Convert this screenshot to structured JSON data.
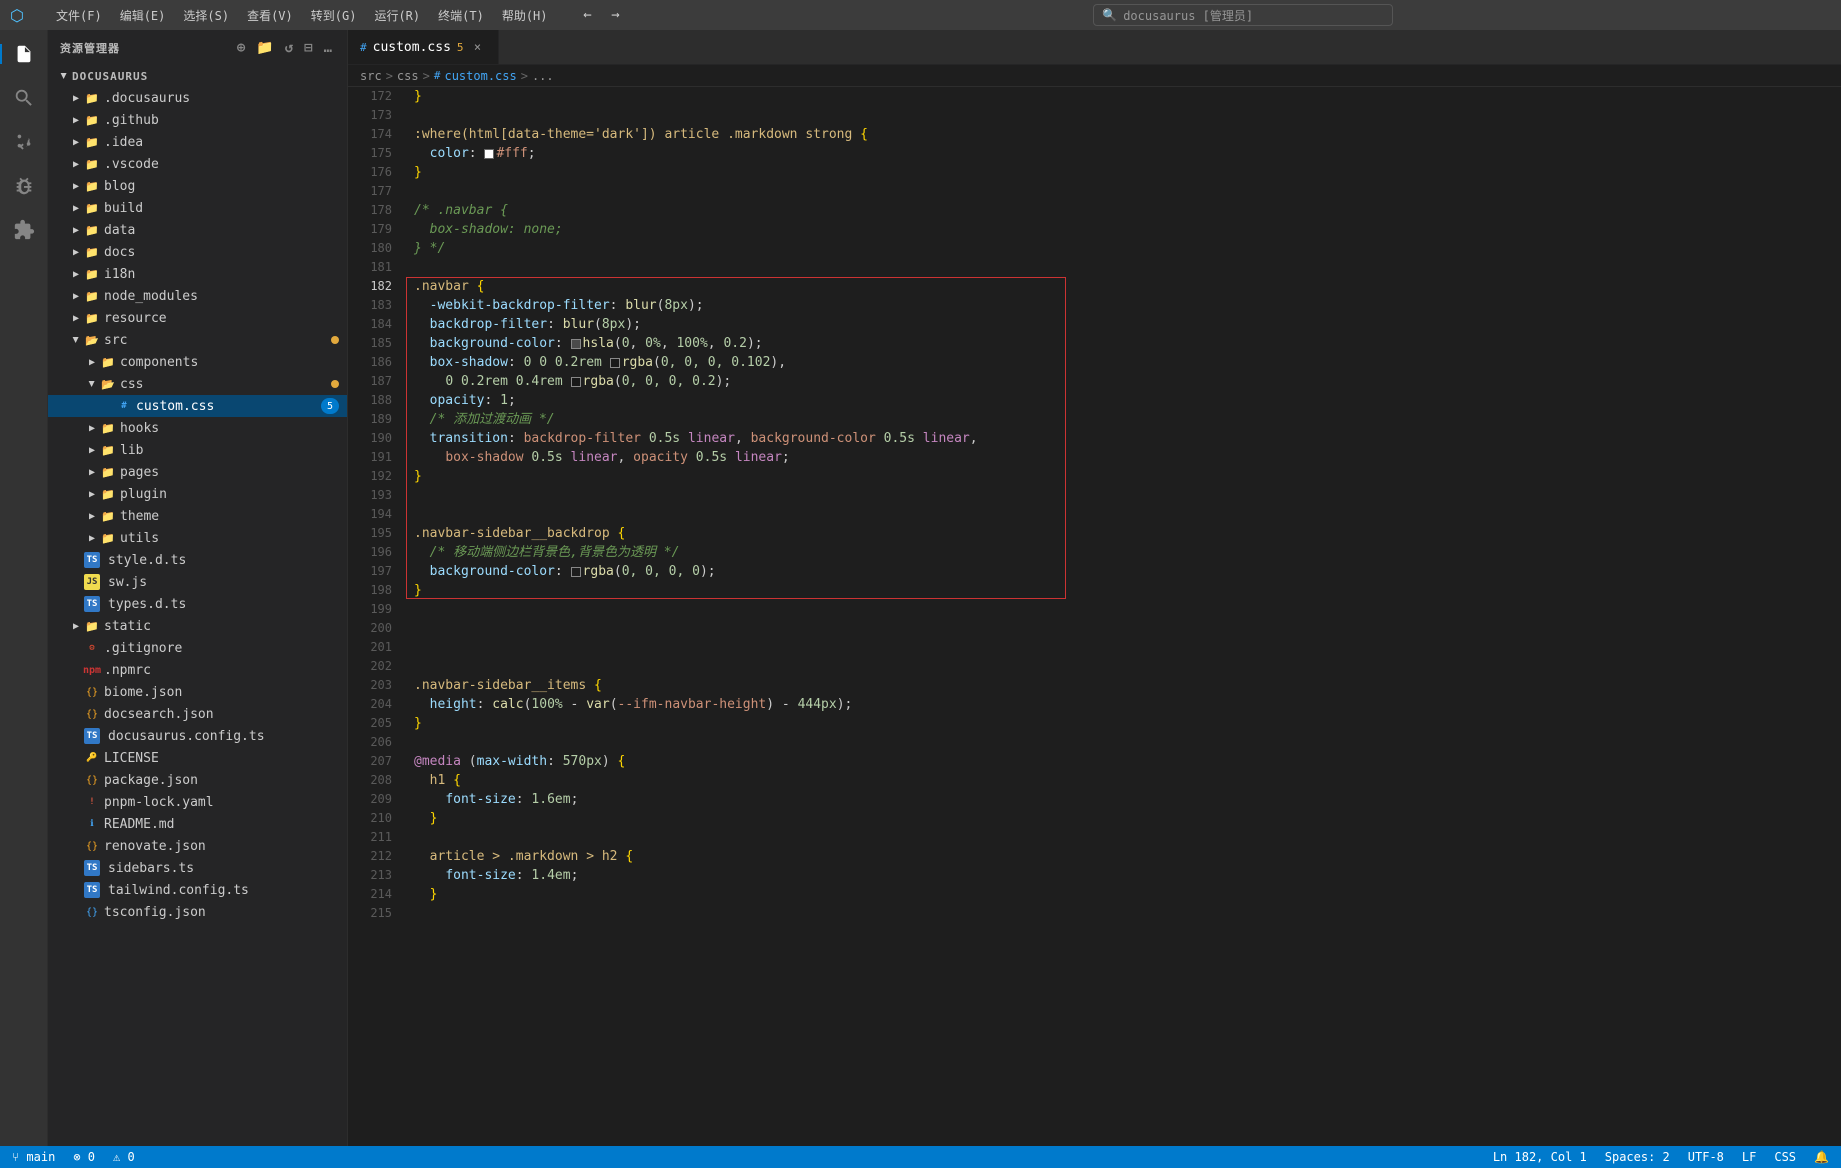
{
  "titlebar": {
    "icon": "⬡",
    "menu": [
      "文件(F)",
      "编辑(E)",
      "选择(S)",
      "查看(V)",
      "转到(G)",
      "运行(R)",
      "终端(T)",
      "帮助(H)"
    ],
    "back_label": "←",
    "forward_label": "→",
    "search_placeholder": "docusaurus [管理员]"
  },
  "sidebar": {
    "title": "资源管理器",
    "root": "DOCUSAURUS",
    "items": [
      {
        "id": "docusaurus",
        "label": ".docusaurus",
        "type": "folder",
        "indent": 1,
        "open": false
      },
      {
        "id": "github",
        "label": ".github",
        "type": "folder",
        "indent": 1,
        "open": false
      },
      {
        "id": "idea",
        "label": ".idea",
        "type": "folder",
        "indent": 1,
        "open": false
      },
      {
        "id": "vscode",
        "label": ".vscode",
        "type": "folder",
        "indent": 1,
        "open": false
      },
      {
        "id": "blog",
        "label": "blog",
        "type": "folder",
        "indent": 1,
        "open": false
      },
      {
        "id": "build",
        "label": "build",
        "type": "folder",
        "indent": 1,
        "open": false
      },
      {
        "id": "data",
        "label": "data",
        "type": "folder",
        "indent": 1,
        "open": false
      },
      {
        "id": "docs",
        "label": "docs",
        "type": "folder",
        "indent": 1,
        "open": false
      },
      {
        "id": "i18n",
        "label": "i18n",
        "type": "folder",
        "indent": 1,
        "open": false
      },
      {
        "id": "node_modules",
        "label": "node_modules",
        "type": "folder",
        "indent": 1,
        "open": false
      },
      {
        "id": "resource",
        "label": "resource",
        "type": "folder",
        "indent": 1,
        "open": false
      },
      {
        "id": "src",
        "label": "src",
        "type": "folder",
        "indent": 1,
        "open": true,
        "dot": true
      },
      {
        "id": "components",
        "label": "components",
        "type": "folder",
        "indent": 2,
        "open": false
      },
      {
        "id": "css",
        "label": "css",
        "type": "folder",
        "indent": 2,
        "open": true,
        "dot": true
      },
      {
        "id": "custom.css",
        "label": "custom.css",
        "type": "css",
        "indent": 3,
        "selected": true,
        "badge": "5"
      },
      {
        "id": "hooks",
        "label": "hooks",
        "type": "folder",
        "indent": 2,
        "open": false
      },
      {
        "id": "lib",
        "label": "lib",
        "type": "folder",
        "indent": 2,
        "open": false
      },
      {
        "id": "pages",
        "label": "pages",
        "type": "folder",
        "indent": 2,
        "open": false
      },
      {
        "id": "plugin",
        "label": "plugin",
        "type": "folder",
        "indent": 2,
        "open": false
      },
      {
        "id": "theme",
        "label": "theme",
        "type": "folder",
        "indent": 2,
        "open": false
      },
      {
        "id": "utils",
        "label": "utils",
        "type": "folder",
        "indent": 2,
        "open": false
      },
      {
        "id": "style.d.ts",
        "label": "style.d.ts",
        "type": "ts",
        "indent": 1
      },
      {
        "id": "sw.js",
        "label": "sw.js",
        "type": "js",
        "indent": 1
      },
      {
        "id": "types.d.ts",
        "label": "types.d.ts",
        "type": "ts",
        "indent": 1
      },
      {
        "id": "static",
        "label": "static",
        "type": "folder",
        "indent": 1,
        "open": false
      },
      {
        "id": ".gitignore",
        "label": ".gitignore",
        "type": "gitignore",
        "indent": 1
      },
      {
        "id": ".npmrc",
        "label": ".npmrc",
        "type": "npmrc",
        "indent": 1
      },
      {
        "id": "biome.json",
        "label": "biome.json",
        "type": "json",
        "indent": 1
      },
      {
        "id": "docsearch.json",
        "label": "docsearch.json",
        "type": "json",
        "indent": 1
      },
      {
        "id": "docusaurus.config.ts",
        "label": "docusaurus.config.ts",
        "type": "ts",
        "indent": 1
      },
      {
        "id": "LICENSE",
        "label": "LICENSE",
        "type": "license",
        "indent": 1
      },
      {
        "id": "package.json",
        "label": "package.json",
        "type": "json",
        "indent": 1
      },
      {
        "id": "pnpm-lock.yaml",
        "label": "pnpm-lock.yaml",
        "type": "yaml",
        "indent": 1
      },
      {
        "id": "README.md",
        "label": "README.md",
        "type": "md",
        "indent": 1
      },
      {
        "id": "renovate.json",
        "label": "renovate.json",
        "type": "json",
        "indent": 1
      },
      {
        "id": "sidebars.ts",
        "label": "sidebars.ts",
        "type": "ts",
        "indent": 1
      },
      {
        "id": "tailwind.config.ts",
        "label": "tailwind.config.ts",
        "type": "ts",
        "indent": 1
      },
      {
        "id": "tsconfig.json",
        "label": "tsconfig.json",
        "type": "json",
        "indent": 1
      }
    ]
  },
  "tab": {
    "icon": "#",
    "name": "custom.css",
    "dirty_count": "5",
    "close": "×"
  },
  "breadcrumb": {
    "src": "src",
    "sep1": ">",
    "css": "css",
    "sep2": ">",
    "hash": "#",
    "file": "custom.css",
    "sep3": ">",
    "dots": "..."
  },
  "lines": [
    {
      "num": 172,
      "content": "}"
    },
    {
      "num": 173,
      "content": ""
    },
    {
      "num": 174,
      "content": ":where(html[data-theme='dark']) article .markdown strong {",
      "type": "selector"
    },
    {
      "num": 175,
      "content": "  color: #fff;",
      "type": "color-prop",
      "color": "#ffffff"
    },
    {
      "num": 176,
      "content": "}",
      "type": "brace"
    },
    {
      "num": 177,
      "content": ""
    },
    {
      "num": 178,
      "content": "/* .navbar {",
      "type": "comment"
    },
    {
      "num": 179,
      "content": "  box-shadow: none;",
      "type": "comment"
    },
    {
      "num": 180,
      "content": "} */",
      "type": "comment"
    },
    {
      "num": 181,
      "content": ""
    },
    {
      "num": 182,
      "content": ".navbar {",
      "type": "selector"
    },
    {
      "num": 183,
      "content": "  -webkit-backdrop-filter: blur(8px);",
      "type": "property"
    },
    {
      "num": 184,
      "content": "  backdrop-filter: blur(8px);",
      "type": "property"
    },
    {
      "num": 185,
      "content": "  background-color: hsla(0, 0%, 100%, 0.2);",
      "type": "color-prop",
      "color": "hsla(0,0%,100%,0.2)"
    },
    {
      "num": 186,
      "content": "  box-shadow: 0 0 0.2rem rgba(0, 0, 0, 0.102),",
      "type": "color-prop",
      "color": "rgba(0,0,0,0.102)"
    },
    {
      "num": 187,
      "content": "    0 0.2rem 0.4rem rgba(0, 0, 0, 0.2);",
      "type": "color-prop2",
      "color": "rgba(0,0,0,0.2)"
    },
    {
      "num": 188,
      "content": "  opacity: 1;",
      "type": "property"
    },
    {
      "num": 189,
      "content": "  /* 添加过渡动画 */",
      "type": "comment-inline"
    },
    {
      "num": 190,
      "content": "  transition: backdrop-filter 0.5s linear, background-color 0.5s linear,",
      "type": "property"
    },
    {
      "num": 191,
      "content": "    box-shadow 0.5s linear, opacity 0.5s linear;",
      "type": "property"
    },
    {
      "num": 192,
      "content": "}",
      "type": "brace"
    },
    {
      "num": 193,
      "content": ""
    },
    {
      "num": 194,
      "content": ""
    },
    {
      "num": 195,
      "content": ".navbar-sidebar__backdrop {",
      "type": "selector"
    },
    {
      "num": 196,
      "content": "  /* 移动端侧边栏背景色,背景色为透明 */",
      "type": "comment-inline"
    },
    {
      "num": 197,
      "content": "  background-color: rgba(0, 0, 0, 0);",
      "type": "color-prop",
      "color": "rgba(0,0,0,0)"
    },
    {
      "num": 198,
      "content": "}",
      "type": "brace"
    },
    {
      "num": 199,
      "content": ""
    },
    {
      "num": 200,
      "content": ""
    },
    {
      "num": 201,
      "content": ""
    },
    {
      "num": 202,
      "content": ""
    },
    {
      "num": 203,
      "content": ".navbar-sidebar__items {",
      "type": "selector"
    },
    {
      "num": 204,
      "content": "  height: calc(100% - var(--ifm-navbar-height) - 444px);",
      "type": "property"
    },
    {
      "num": 205,
      "content": "}",
      "type": "brace"
    },
    {
      "num": 206,
      "content": ""
    },
    {
      "num": 207,
      "content": "@media (max-width: 570px) {",
      "type": "at-rule"
    },
    {
      "num": 208,
      "content": "  h1 {",
      "type": "selector-inner"
    },
    {
      "num": 209,
      "content": "    font-size: 1.6em;",
      "type": "property-inner"
    },
    {
      "num": 210,
      "content": "  }",
      "type": "brace"
    },
    {
      "num": 211,
      "content": ""
    },
    {
      "num": 212,
      "content": "  article > .markdown > h2 {",
      "type": "selector-inner"
    },
    {
      "num": 213,
      "content": "    font-size: 1.4em;",
      "type": "property-inner"
    },
    {
      "num": 214,
      "content": "  }",
      "type": "brace"
    },
    {
      "num": 215,
      "content": ""
    }
  ],
  "status": {
    "git": "⑂ main",
    "errors": "⊗ 0",
    "warnings": "⚠ 0",
    "remote": "⇄",
    "ln_col": "Ln 182, Col 1",
    "spaces": "Spaces: 2",
    "encoding": "UTF-8",
    "eol": "LF",
    "language": "CSS",
    "notifications": "🔔"
  }
}
